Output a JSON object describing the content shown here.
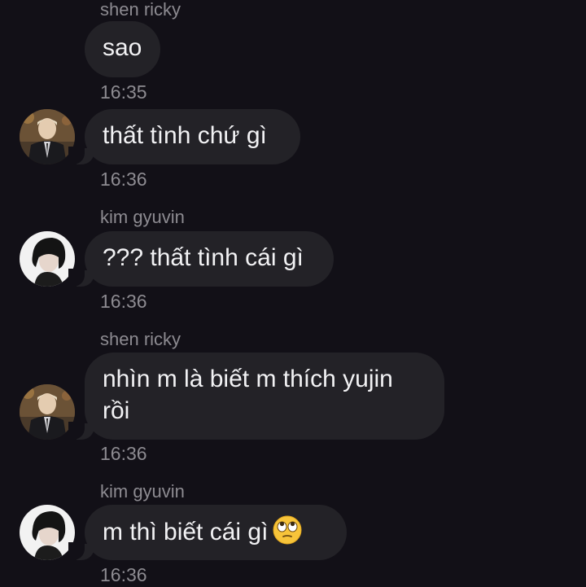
{
  "messages": [
    {
      "sender": "shen ricky",
      "text": "sao",
      "time": "16:35"
    },
    {
      "text": "thất tình chứ gì",
      "time": "16:36",
      "avatar": "person-suit-photo-avatar"
    },
    {
      "sender": "kim gyuvin",
      "text": "??? thất tình cái gì",
      "time": "16:36",
      "avatar": "person-dark-hair-photo-avatar"
    },
    {
      "sender": "shen ricky",
      "text_line1": "nhìn m là biết m thích yujin",
      "text_line2": "rồi",
      "time": "16:36",
      "avatar": "person-suit-photo-avatar"
    },
    {
      "sender": "kim gyuvin",
      "text": "m thì biết cái gì",
      "emoji": "face-with-rolling-eyes",
      "time": "16:36",
      "avatar": "person-dark-hair-photo-avatar"
    }
  ],
  "colors": {
    "background": "#121017",
    "bubble": "#232227",
    "bubble_text": "#f2f2f4",
    "meta_text": "#8d8b91"
  }
}
